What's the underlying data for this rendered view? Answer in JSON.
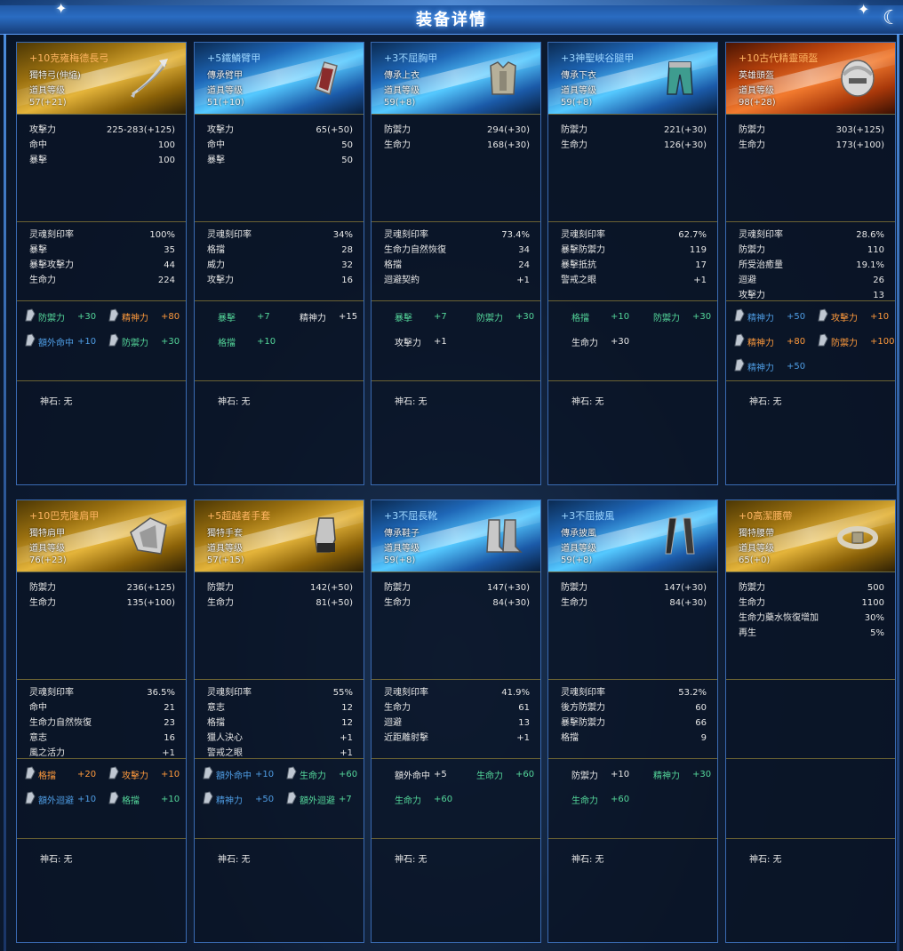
{
  "title": "装备详情",
  "colors": {
    "orange": "#ff9a3c",
    "green": "#54d69a",
    "blue": "#4f9ee6",
    "white": "#e8e8e8"
  },
  "items": [
    {
      "name": "+10克雍梅德長弓",
      "name_color": "orange",
      "banner": "gold",
      "type": "獨特弓(伸縮)",
      "level_label": "道具等级",
      "level": "57(+21)",
      "icon": "bow-icon",
      "base_stats": [
        [
          "攻擊力",
          "225-283(+125)"
        ],
        [
          "命中",
          "100"
        ],
        [
          "暴擊",
          "100"
        ]
      ],
      "extra_stats": [
        [
          "灵魂刻印率",
          "100%"
        ],
        [
          "暴擊",
          "35"
        ],
        [
          "暴擊攻擊力",
          "44"
        ],
        [
          "生命力",
          "224"
        ]
      ],
      "runes": [
        {
          "name": "防禦力",
          "value": "+30",
          "color": "green",
          "gem": true
        },
        {
          "name": "精神力",
          "value": "+80",
          "color": "orange",
          "gem": true
        },
        {
          "name": "額外命中",
          "value": "+10",
          "color": "blue",
          "gem": true
        },
        {
          "name": "防禦力",
          "value": "+30",
          "color": "green",
          "gem": true
        }
      ],
      "stone": "神石: 无"
    },
    {
      "name": "+5鐵鱗臂甲",
      "name_color": "blue",
      "banner": "blue",
      "type": "傳承臂甲",
      "level_label": "道具等级",
      "level": "51(+10)",
      "icon": "bracer-icon",
      "base_stats": [
        [
          "攻擊力",
          "65(+50)"
        ],
        [
          "命中",
          "50"
        ],
        [
          "暴擊",
          "50"
        ]
      ],
      "extra_stats": [
        [
          "灵魂刻印率",
          "34%"
        ],
        [
          "格擋",
          "28"
        ],
        [
          "威力",
          "32"
        ],
        [
          "攻擊力",
          "16"
        ]
      ],
      "runes": [
        {
          "name": "暴擊",
          "value": "+7",
          "color": "green",
          "gem": false
        },
        {
          "name": "精神力",
          "value": "+15",
          "color": "white",
          "gem": false
        },
        {
          "name": "格擋",
          "value": "+10",
          "color": "green",
          "gem": false
        }
      ],
      "stone": "神石: 无"
    },
    {
      "name": "+3不屈胸甲",
      "name_color": "blue",
      "banner": "blue",
      "type": "傳承上衣",
      "level_label": "道具等级",
      "level": "59(+8)",
      "icon": "chest-armor-icon",
      "base_stats": [
        [
          "防禦力",
          "294(+30)"
        ],
        [
          "生命力",
          "168(+30)"
        ]
      ],
      "extra_stats": [
        [
          "灵魂刻印率",
          "73.4%"
        ],
        [
          "生命力自然恢復",
          "34"
        ],
        [
          "格擋",
          "24"
        ],
        [
          "迴避契約",
          "+1"
        ]
      ],
      "runes": [
        {
          "name": "暴擊",
          "value": "+7",
          "color": "green",
          "gem": false
        },
        {
          "name": "防禦力",
          "value": "+30",
          "color": "green",
          "gem": false
        },
        {
          "name": "攻擊力",
          "value": "+1",
          "color": "white",
          "gem": false
        }
      ],
      "stone": "神石: 无"
    },
    {
      "name": "+3神聖峽谷腿甲",
      "name_color": "blue",
      "banner": "blue",
      "type": "傳承下衣",
      "level_label": "道具等级",
      "level": "59(+8)",
      "icon": "leg-armor-icon",
      "base_stats": [
        [
          "防禦力",
          "221(+30)"
        ],
        [
          "生命力",
          "126(+30)"
        ]
      ],
      "extra_stats": [
        [
          "灵魂刻印率",
          "62.7%"
        ],
        [
          "暴擊防禦力",
          "119"
        ],
        [
          "暴擊抵抗",
          "17"
        ],
        [
          "警戒之眼",
          "+1"
        ]
      ],
      "runes": [
        {
          "name": "格擋",
          "value": "+10",
          "color": "green",
          "gem": false
        },
        {
          "name": "防禦力",
          "value": "+30",
          "color": "green",
          "gem": false
        },
        {
          "name": "生命力",
          "value": "+30",
          "color": "white",
          "gem": false
        }
      ],
      "stone": "神石: 无"
    },
    {
      "name": "+10古代精靈頭盔",
      "name_color": "orange",
      "banner": "orange",
      "type": "英雄頭盔",
      "level_label": "道具等级",
      "level": "98(+28)",
      "icon": "helmet-icon",
      "base_stats": [
        [
          "防禦力",
          "303(+125)"
        ],
        [
          "生命力",
          "173(+100)"
        ]
      ],
      "extra_stats": [
        [
          "灵魂刻印率",
          "28.6%"
        ],
        [
          "防禦力",
          "110"
        ],
        [
          "所受治癒量",
          "19.1%"
        ],
        [
          "迴避",
          "26"
        ],
        [
          "攻擊力",
          "13"
        ]
      ],
      "runes": [
        {
          "name": "精神力",
          "value": "+50",
          "color": "blue",
          "gem": true
        },
        {
          "name": "攻擊力",
          "value": "+10",
          "color": "orange",
          "gem": true
        },
        {
          "name": "精神力",
          "value": "+80",
          "color": "orange",
          "gem": true
        },
        {
          "name": "防禦力",
          "value": "+100",
          "color": "orange",
          "gem": true
        },
        {
          "name": "精神力",
          "value": "+50",
          "color": "blue",
          "gem": true
        }
      ],
      "stone": "神石: 无"
    },
    {
      "name": "+10巴克隆肩甲",
      "name_color": "orange",
      "banner": "gold",
      "type": "獨特肩甲",
      "level_label": "道具等级",
      "level": "76(+23)",
      "icon": "shoulder-armor-icon",
      "base_stats": [
        [
          "防禦力",
          "236(+125)"
        ],
        [
          "生命力",
          "135(+100)"
        ]
      ],
      "extra_stats": [
        [
          "灵魂刻印率",
          "36.5%"
        ],
        [
          "命中",
          "21"
        ],
        [
          "生命力自然恢復",
          "23"
        ],
        [
          "意志",
          "16"
        ],
        [
          "風之活力",
          "+1"
        ]
      ],
      "runes": [
        {
          "name": "格擋",
          "value": "+20",
          "color": "orange",
          "gem": true
        },
        {
          "name": "攻擊力",
          "value": "+10",
          "color": "orange",
          "gem": true
        },
        {
          "name": "額外迴避",
          "value": "+10",
          "color": "blue",
          "gem": true
        },
        {
          "name": "格擋",
          "value": "+10",
          "color": "green",
          "gem": true
        }
      ],
      "stone": "神石: 无"
    },
    {
      "name": "+5超越者手套",
      "name_color": "orange",
      "banner": "gold",
      "type": "獨特手套",
      "level_label": "道具等级",
      "level": "57(+15)",
      "icon": "gauntlet-icon",
      "base_stats": [
        [
          "防禦力",
          "142(+50)"
        ],
        [
          "生命力",
          "81(+50)"
        ]
      ],
      "extra_stats": [
        [
          "灵魂刻印率",
          "55%"
        ],
        [
          "意志",
          "12"
        ],
        [
          "格擋",
          "12"
        ],
        [
          "獵人決心",
          "+1"
        ],
        [
          "警戒之眼",
          "+1"
        ]
      ],
      "runes": [
        {
          "name": "額外命中",
          "value": "+10",
          "color": "blue",
          "gem": true
        },
        {
          "name": "生命力",
          "value": "+60",
          "color": "green",
          "gem": true
        },
        {
          "name": "精神力",
          "value": "+50",
          "color": "blue",
          "gem": true
        },
        {
          "name": "額外迴避",
          "value": "+7",
          "color": "green",
          "gem": true
        }
      ],
      "stone": "神石: 无"
    },
    {
      "name": "+3不屈長靴",
      "name_color": "blue",
      "banner": "blue",
      "type": "傳承鞋子",
      "level_label": "道具等级",
      "level": "59(+8)",
      "icon": "boots-icon",
      "base_stats": [
        [
          "防禦力",
          "147(+30)"
        ],
        [
          "生命力",
          "84(+30)"
        ]
      ],
      "extra_stats": [
        [
          "灵魂刻印率",
          "41.9%"
        ],
        [
          "生命力",
          "61"
        ],
        [
          "迴避",
          "13"
        ],
        [
          "近距離射擊",
          "+1"
        ]
      ],
      "runes": [
        {
          "name": "額外命中",
          "value": "+5",
          "color": "white",
          "gem": false
        },
        {
          "name": "生命力",
          "value": "+60",
          "color": "green",
          "gem": false
        },
        {
          "name": "生命力",
          "value": "+60",
          "color": "green",
          "gem": false
        }
      ],
      "stone": "神石: 无"
    },
    {
      "name": "+3不屈披風",
      "name_color": "blue",
      "banner": "blue",
      "type": "傳承披風",
      "level_label": "道具等级",
      "level": "59(+8)",
      "icon": "cloak-icon",
      "base_stats": [
        [
          "防禦力",
          "147(+30)"
        ],
        [
          "生命力",
          "84(+30)"
        ]
      ],
      "extra_stats": [
        [
          "灵魂刻印率",
          "53.2%"
        ],
        [
          "後方防禦力",
          "60"
        ],
        [
          "暴擊防禦力",
          "66"
        ],
        [
          "格擋",
          "9"
        ]
      ],
      "runes": [
        {
          "name": "防禦力",
          "value": "+10",
          "color": "white",
          "gem": false
        },
        {
          "name": "精神力",
          "value": "+30",
          "color": "green",
          "gem": false
        },
        {
          "name": "生命力",
          "value": "+60",
          "color": "green",
          "gem": false
        }
      ],
      "stone": "神石: 无"
    },
    {
      "name": "+0高潔腰帶",
      "name_color": "orange",
      "banner": "gold",
      "type": "獨特腰帶",
      "level_label": "道具等级",
      "level": "65(+0)",
      "icon": "belt-icon",
      "base_stats": [
        [
          "防禦力",
          "500"
        ],
        [
          "生命力",
          "1100"
        ],
        [
          "生命力藥水恢復增加",
          "30%"
        ],
        [
          "再生",
          "5%"
        ]
      ],
      "extra_stats": [],
      "runes": [],
      "stone": "神石: 无"
    }
  ]
}
